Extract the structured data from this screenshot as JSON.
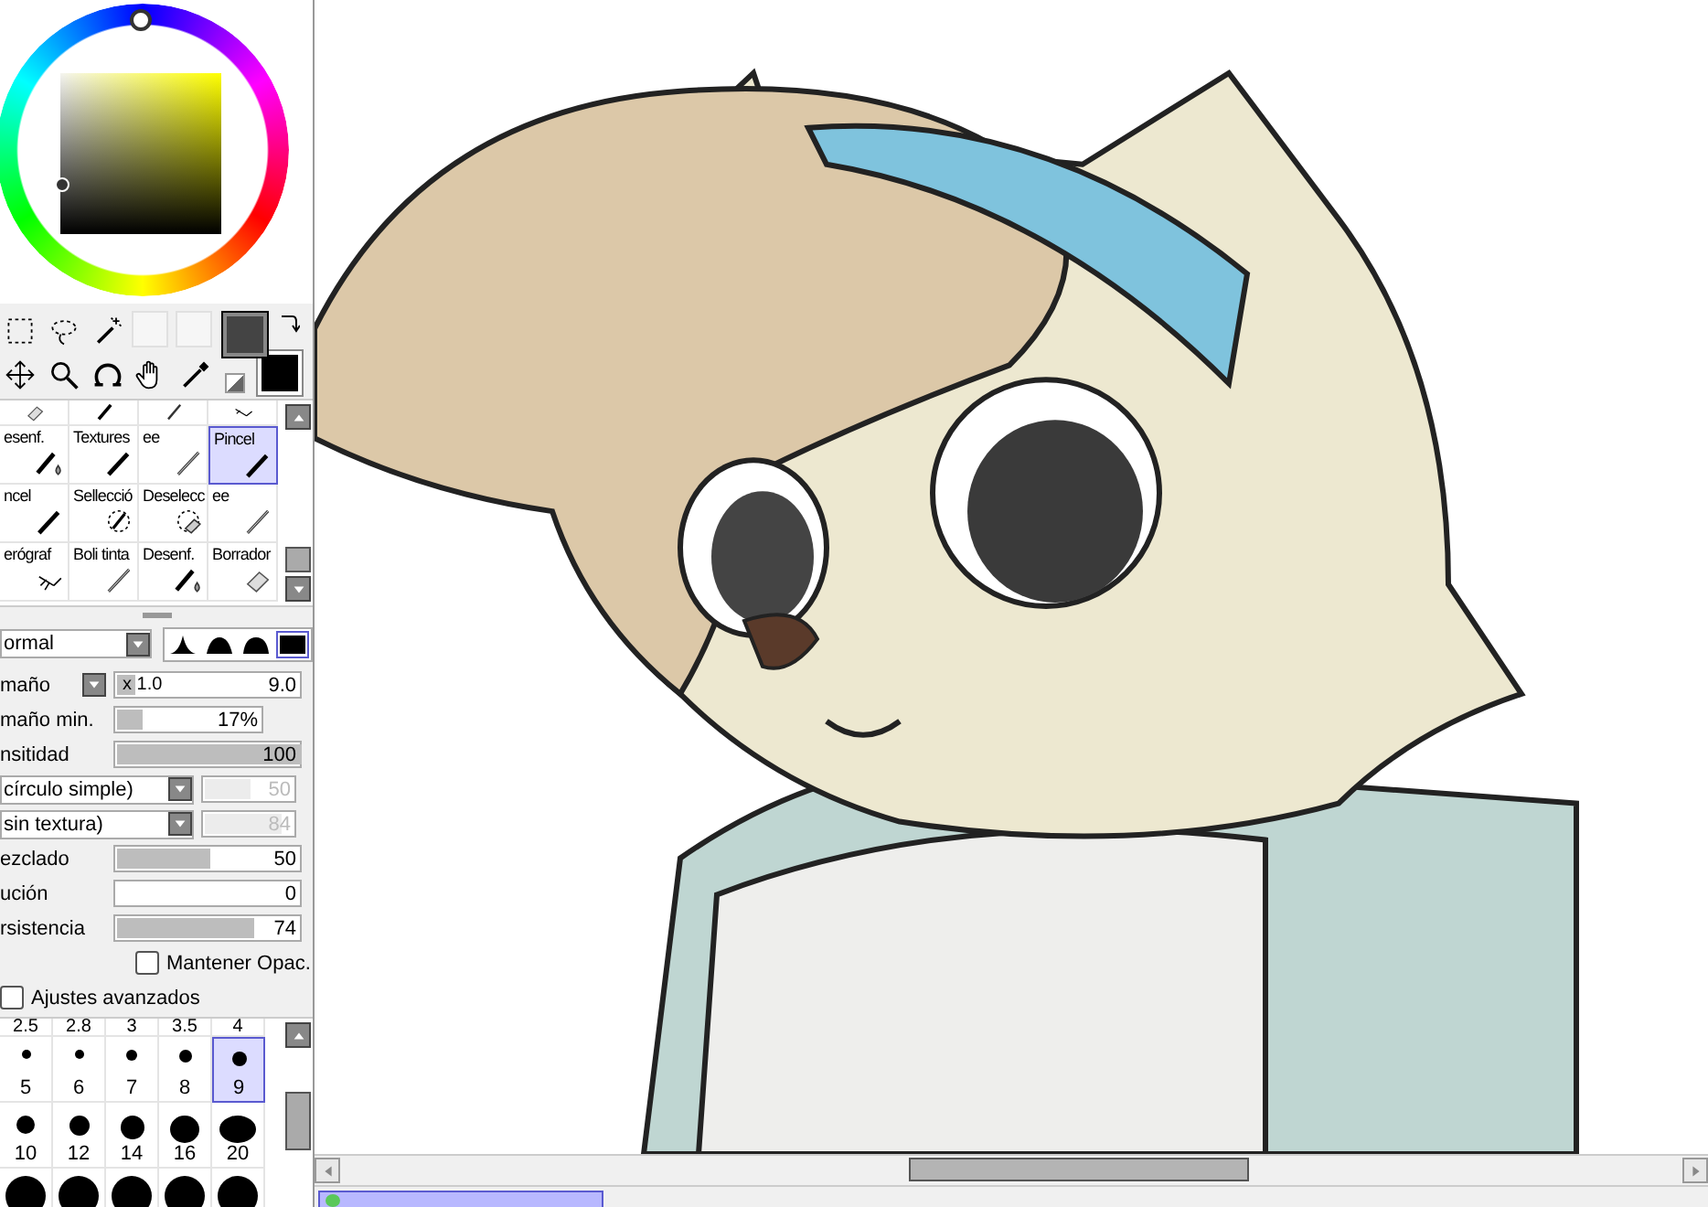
{
  "brush_tools": {
    "top_row": [
      {
        "kind": "eraser"
      },
      {
        "kind": "pen"
      },
      {
        "kind": "pencil"
      },
      {
        "kind": "airbrush"
      }
    ],
    "cells": [
      {
        "label": "esenf.",
        "kind": "pen-drop",
        "selected": false
      },
      {
        "label": "Textures",
        "kind": "pen",
        "selected": false
      },
      {
        "label": "ee",
        "kind": "pencil",
        "selected": false
      },
      {
        "label": "Pincel",
        "kind": "pen",
        "selected": true
      },
      {
        "label": "ncel",
        "kind": "pen",
        "selected": false
      },
      {
        "label": "Sellecció",
        "kind": "selection",
        "selected": false
      },
      {
        "label": "Deselecc",
        "kind": "deselect",
        "selected": false
      },
      {
        "label": "ee",
        "kind": "pencil",
        "selected": false
      },
      {
        "label": "erógraf",
        "kind": "airbrush",
        "selected": false
      },
      {
        "label": "Boli tinta",
        "kind": "pencil",
        "selected": false
      },
      {
        "label": "Desenf.",
        "kind": "pen-drop",
        "selected": false
      },
      {
        "label": "Borrador",
        "kind": "eraser",
        "selected": false
      }
    ]
  },
  "blend": {
    "mode": "ormal",
    "shapes": [
      {
        "selected": false
      },
      {
        "selected": false
      },
      {
        "selected": false
      },
      {
        "selected": true
      }
    ]
  },
  "properties": [
    {
      "kind": "slider",
      "label": "maño",
      "menu": true,
      "prefix": "x 1.0",
      "value": "9.0",
      "level": 0.1,
      "disabled": false
    },
    {
      "kind": "slider",
      "label": "maño min.",
      "value": "17%",
      "level": 0.17,
      "disabled": false,
      "short": true
    },
    {
      "kind": "slider",
      "label": "nsitidad",
      "value": "100",
      "level": 1,
      "disabled": false
    },
    {
      "kind": "dropdown",
      "label": "círculo simple)",
      "value": "50",
      "level": 0.5,
      "disabled": true
    },
    {
      "kind": "dropdown",
      "label": "sin textura)",
      "value": "84",
      "level": 0.84,
      "disabled": true
    },
    {
      "kind": "slider",
      "label": "ezclado",
      "value": "50",
      "level": 0.5,
      "disabled": false
    },
    {
      "kind": "slider",
      "label": "ución",
      "value": "0",
      "level": 0,
      "disabled": false
    },
    {
      "kind": "slider",
      "label": "rsistencia",
      "value": "74",
      "level": 0.74,
      "disabled": false
    },
    {
      "kind": "checkbox",
      "label": "Mantener Opac.",
      "checked": false
    },
    {
      "kind": "section-toggle",
      "label": "Ajustes avanzados",
      "checked": false
    }
  ],
  "sizes": {
    "header": [
      "2.5",
      "2.8",
      "3",
      "3.5",
      "4"
    ],
    "rows": [
      [
        {
          "label": "5",
          "selected": false
        },
        {
          "label": "6",
          "selected": false
        },
        {
          "label": "7",
          "selected": false
        },
        {
          "label": "8",
          "selected": false
        },
        {
          "label": "9",
          "selected": true
        }
      ],
      [
        {
          "label": "10",
          "selected": false
        },
        {
          "label": "12",
          "selected": false
        },
        {
          "label": "14",
          "selected": false
        },
        {
          "label": "16",
          "selected": false
        },
        {
          "label": "20",
          "selected": false
        }
      ]
    ]
  }
}
